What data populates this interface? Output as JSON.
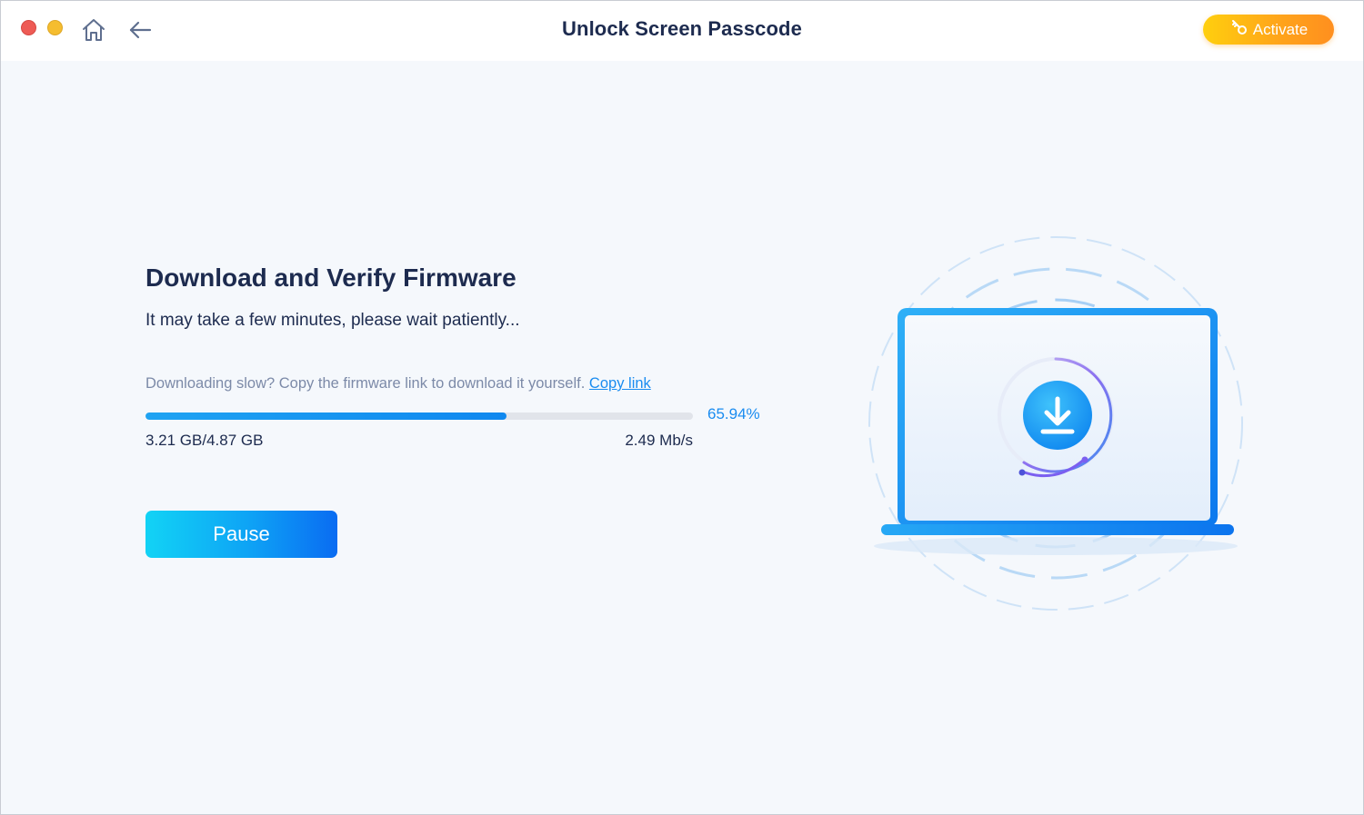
{
  "window": {
    "title": "Unlock Screen Passcode",
    "controls": [
      "close",
      "minimize"
    ]
  },
  "toolbar": {
    "home_icon": "home-icon",
    "back_icon": "arrow-left-icon",
    "activate_label": "Activate",
    "activate_icon": "key-icon"
  },
  "main": {
    "heading": "Download and Verify Firmware",
    "subtitle": "It may take a few minutes, please wait patiently...",
    "hint_text": "Downloading slow? Copy the firmware link to download it yourself.",
    "copy_link_label": "Copy link",
    "progress": {
      "percent_label": "65.94%",
      "fraction": 0.6594,
      "downloaded": "3.21 GB/4.87 GB",
      "speed": "2.49 Mb/s"
    },
    "pause_label": "Pause"
  },
  "illustration": {
    "icon": "download-icon",
    "device": "laptop-icon"
  },
  "colors": {
    "accent": "#1a8cf0",
    "activate_gradient": [
      "#ffcf0e",
      "#ff8f1f"
    ],
    "pause_gradient": [
      "#12d3f5",
      "#0a6cf2"
    ],
    "heading": "#1d2b4f",
    "hint": "#7c8aa8"
  }
}
